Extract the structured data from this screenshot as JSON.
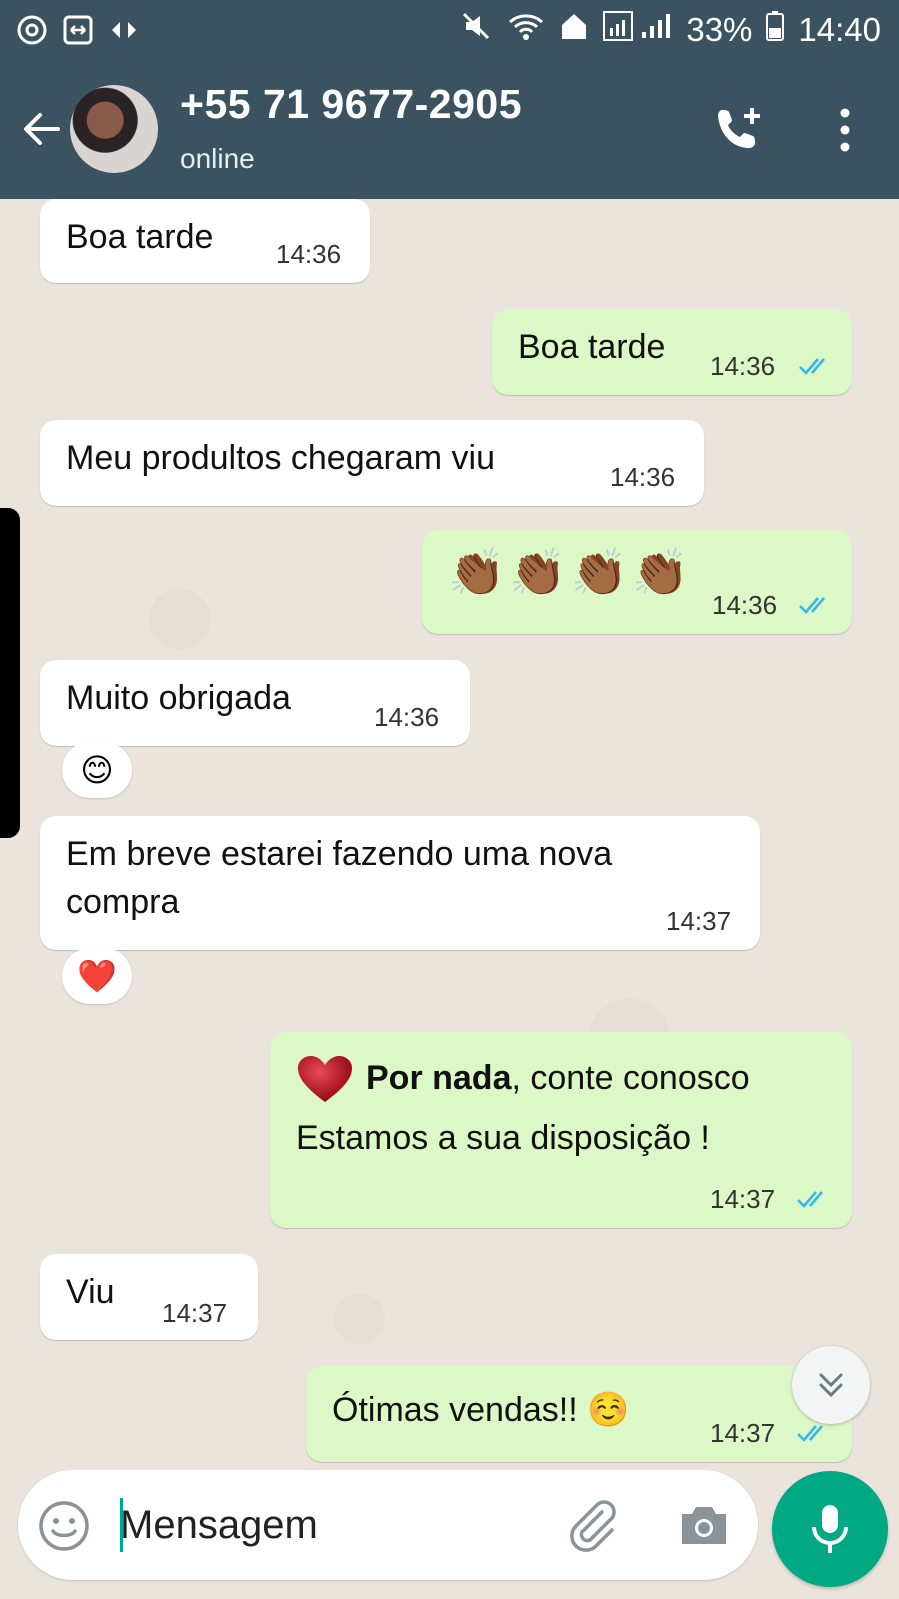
{
  "status_bar": {
    "battery": "33%",
    "time": "14:40"
  },
  "header": {
    "contact": "+55 71 9677-2905",
    "status": "online"
  },
  "messages": [
    {
      "dir": "in",
      "text": "Boa tarde",
      "time": "14:36"
    },
    {
      "dir": "out",
      "text": "Boa tarde",
      "time": "14:36",
      "read": true
    },
    {
      "dir": "in",
      "text": "Meu produltos chegaram viu",
      "time": "14:36"
    },
    {
      "dir": "out",
      "text": "👏🏾👏🏾👏🏾👏🏾",
      "time": "14:36",
      "read": true
    },
    {
      "dir": "in",
      "text": "Muito obrigada",
      "time": "14:36",
      "reaction": "😊"
    },
    {
      "dir": "in",
      "text": "Em breve estarei fazendo uma nova\ncompra",
      "time": "14:37",
      "reaction": "❤️"
    },
    {
      "dir": "out",
      "bold": "Por nada",
      "text": ", conte conosco",
      "text2": "Estamos a sua disposição !",
      "time": "14:37",
      "read": true
    },
    {
      "dir": "in",
      "text": "Viu",
      "time": "14:37"
    },
    {
      "dir": "out",
      "text": "Ótimas vendas!! ☺️",
      "time": "14:37",
      "read": true
    }
  ],
  "composer": {
    "placeholder": "Mensagem"
  },
  "colors": {
    "header": "#3b5260",
    "outgoing_bubble": "#dcf8c6",
    "incoming_bubble": "#ffffff",
    "read_ticks": "#34b7f1",
    "mic_button": "#00a884"
  }
}
